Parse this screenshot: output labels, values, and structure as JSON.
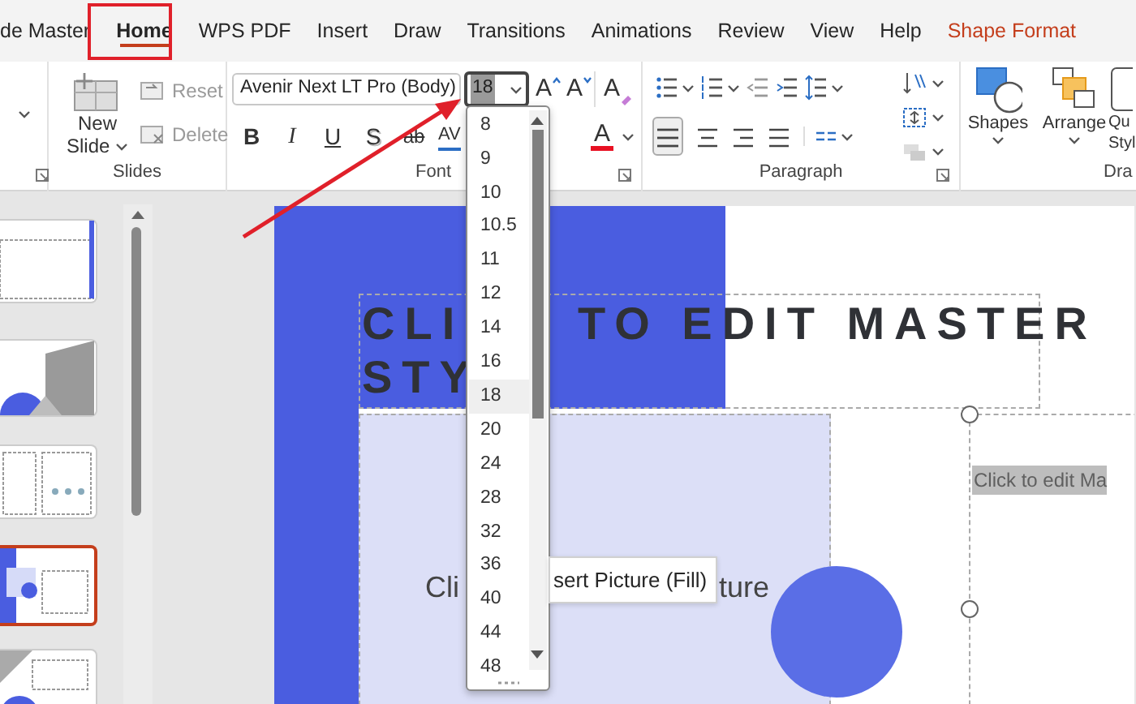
{
  "tabs": [
    {
      "label": "de Master",
      "selected": false,
      "kind": "standard"
    },
    {
      "label": "Home",
      "selected": true,
      "kind": "standard"
    },
    {
      "label": "WPS PDF",
      "selected": false,
      "kind": "standard"
    },
    {
      "label": "Insert",
      "selected": false,
      "kind": "standard"
    },
    {
      "label": "Draw",
      "selected": false,
      "kind": "standard"
    },
    {
      "label": "Transitions",
      "selected": false,
      "kind": "standard"
    },
    {
      "label": "Animations",
      "selected": false,
      "kind": "standard"
    },
    {
      "label": "Review",
      "selected": false,
      "kind": "standard"
    },
    {
      "label": "View",
      "selected": false,
      "kind": "standard"
    },
    {
      "label": "Help",
      "selected": false,
      "kind": "standard"
    },
    {
      "label": "Shape Format",
      "selected": false,
      "kind": "contextual"
    }
  ],
  "slides_group": {
    "label": "Slides",
    "new_slide": [
      "New",
      "Slide"
    ],
    "actions": [
      {
        "label": "Reset",
        "disabled": true
      },
      {
        "label": "Delete",
        "disabled": true
      }
    ]
  },
  "font_group": {
    "label": "Font",
    "font_name": "Avenir Next LT Pro (Body)",
    "font_size": "18",
    "size_buttons": [
      "A",
      "A"
    ],
    "clear_button": "A",
    "format_buttons": [
      {
        "label": "B",
        "kind": "bold"
      },
      {
        "label": "I",
        "kind": "italic"
      },
      {
        "label": "U",
        "kind": "underline"
      },
      {
        "label": "S",
        "kind": "shadow"
      },
      {
        "label": "ab",
        "kind": "strike"
      },
      {
        "label": "AV",
        "kind": "spacing"
      }
    ],
    "font_color": {
      "label": "A",
      "color": "#e81123"
    }
  },
  "paragraph_group": {
    "label": "Paragraph"
  },
  "drawing_group": {
    "label": "Dra",
    "buttons": [
      {
        "label": "Shapes"
      },
      {
        "label": "Arrange"
      },
      {
        "label": "Qu\nStyl"
      }
    ]
  },
  "thumbnails": [
    {
      "selected": false
    },
    {
      "selected": false
    },
    {
      "selected": false
    },
    {
      "selected": true
    },
    {
      "selected": false
    }
  ],
  "slide": {
    "title_parts": [
      "CLI",
      "TO EDIT MASTER",
      "STY"
    ],
    "body_parts": [
      "Cli",
      "ture"
    ],
    "right_placeholder": "Click to edit Ma"
  },
  "size_dropdown": {
    "items": [
      {
        "label": "8",
        "selected": false
      },
      {
        "label": "9",
        "selected": false
      },
      {
        "label": "10",
        "selected": false
      },
      {
        "label": "10.5",
        "selected": false
      },
      {
        "label": "11",
        "selected": false
      },
      {
        "label": "12",
        "selected": false
      },
      {
        "label": "14",
        "selected": false
      },
      {
        "label": "16",
        "selected": false
      },
      {
        "label": "18",
        "selected": true
      },
      {
        "label": "20",
        "selected": false
      },
      {
        "label": "24",
        "selected": false
      },
      {
        "label": "28",
        "selected": false
      },
      {
        "label": "32",
        "selected": false
      },
      {
        "label": "36",
        "selected": false
      },
      {
        "label": "40",
        "selected": false
      },
      {
        "label": "44",
        "selected": false
      },
      {
        "label": "48",
        "selected": false
      }
    ]
  },
  "tooltip": "sert Picture (Fill)"
}
